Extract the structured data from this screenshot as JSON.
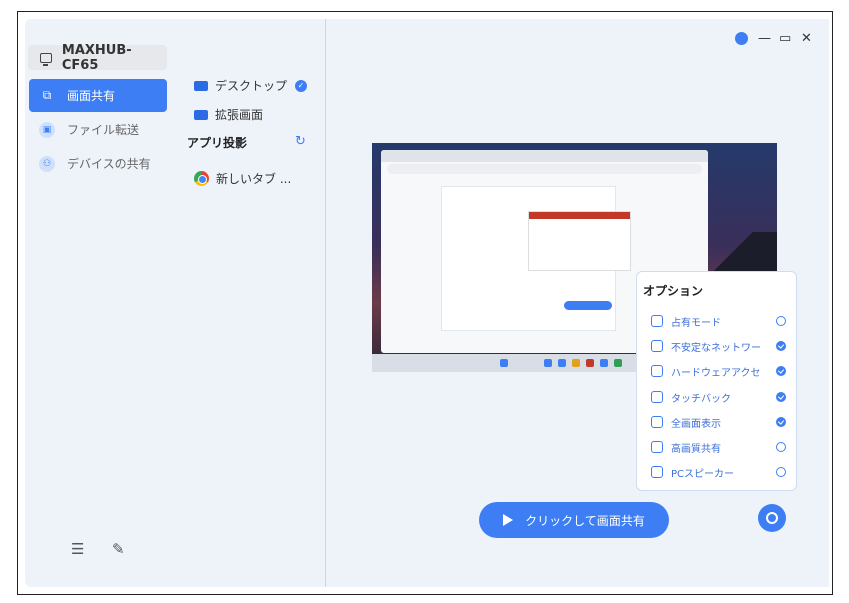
{
  "sidebar": {
    "device_name": "MAXHUB-CF65",
    "items": [
      {
        "label": "画面共有",
        "icon": "screen-share-icon"
      },
      {
        "label": "ファイル転送",
        "icon": "file-transfer-icon"
      },
      {
        "label": "デバイスの共有",
        "icon": "device-share-icon"
      }
    ],
    "bottom_icons": [
      "menu-icon",
      "feedback-icon"
    ]
  },
  "midcol": {
    "items": [
      {
        "label": "デスクトップ",
        "checked": true
      },
      {
        "label": "拡張画面"
      }
    ],
    "section_title": "アプリ投影",
    "apps": [
      {
        "label": "新しいタブ ...",
        "icon": "chrome-icon"
      }
    ]
  },
  "window_controls": [
    "pin-icon",
    "minimize-icon",
    "maximize-icon",
    "close-icon"
  ],
  "options": {
    "title": "オプション",
    "items": [
      {
        "label": "占有モード",
        "checked": false
      },
      {
        "label": "不安定なネットワー",
        "checked": true
      },
      {
        "label": "ハードウェアアクセ",
        "checked": true
      },
      {
        "label": "タッチバック",
        "checked": true
      },
      {
        "label": "全画面表示",
        "checked": true
      },
      {
        "label": "高画質共有",
        "checked": false
      },
      {
        "label": "PCスピーカー",
        "checked": false
      }
    ]
  },
  "actions": {
    "share_label": "クリックして画面共有"
  },
  "colors": {
    "accent": "#3d7ef5",
    "background": "#eef3fa"
  }
}
